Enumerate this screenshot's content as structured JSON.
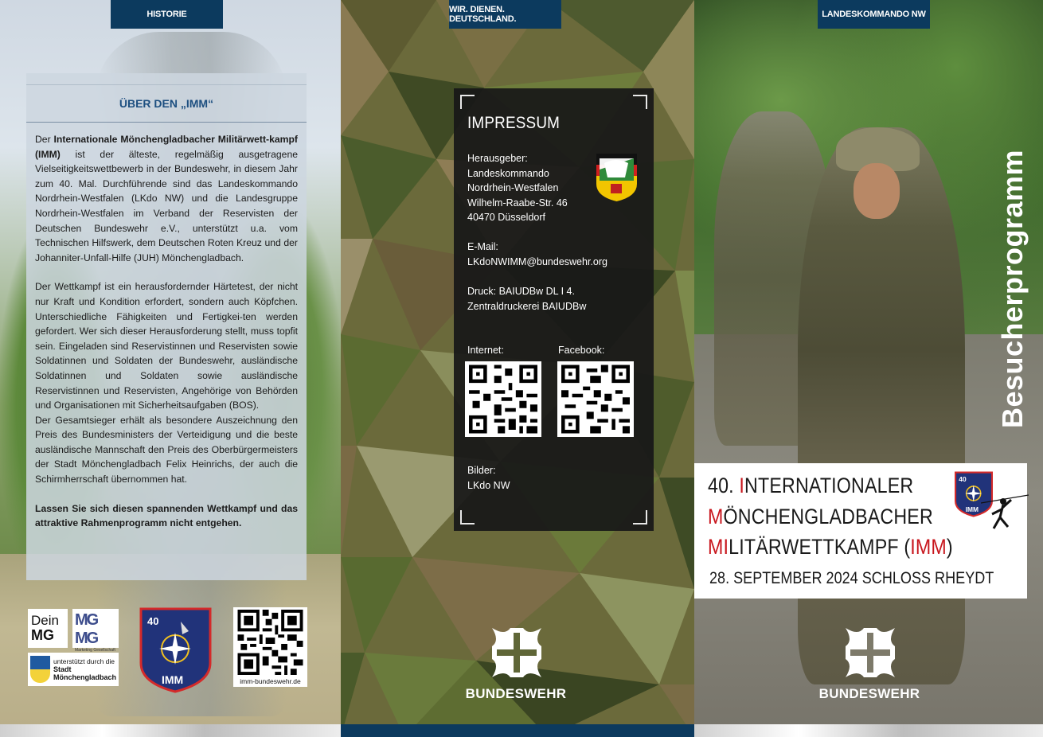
{
  "left": {
    "tab": "HISTORIE",
    "heading": "ÜBER DEN „IMM“",
    "p1_pre": "Der ",
    "p1_bold": "Internationale Mönchengladbacher Militärwett-kampf (IMM)",
    "p1_rest": " ist der älteste, regelmäßig ausgetragene Vielseitigkeitswettbewerb in der Bundeswehr, in diesem Jahr zum 40. Mal. Durchführende sind das Landeskommando Nordrhein-Westfalen (LKdo NW) und die Landesgruppe Nordrhein-Westfalen im Verband der Reservisten der Deutschen Bundeswehr e.V., unterstützt u.a. vom Technischen Hilfswerk, dem Deutschen Roten Kreuz und der Johanniter-Unfall-Hilfe (JUH) Mönchengladbach.",
    "p2": "Der Wettkampf ist ein herausfordernder Härtetest, der nicht nur Kraft und Kondition erfordert, sondern auch Köpfchen. Unterschiedliche Fähigkeiten und Fertigkei-ten werden gefordert. Wer sich dieser Herausforderung stellt, muss topfit sein. Eingeladen sind Reservistinnen und Reservisten sowie Soldatinnen und Soldaten der Bundeswehr, ausländische Soldatinnen und Soldaten sowie ausländische Reservistinnen und Reservisten, Angehörige von Behörden und Organisationen mit Sicherheitsaufgaben (BOS).",
    "p3": "Der Gesamtsieger erhält als besondere Auszeichnung den Preis des Bundesministers der Verteidigung und die beste ausländische Mannschaft den Preis des Oberbürgermeisters der Stadt Mönchengladbach Felix Heinrichs, der auch die Schirmherrschaft übernommen hat.",
    "closing_bold": "Lassen Sie sich diesen spannenden Wettkampf und das attraktive Rahmenprogramm nicht entgehen.",
    "logos": {
      "dein": "Dein",
      "mg": "MG",
      "mgmg": "MG MG",
      "mgmg_sub": "Marketing Gesellschaft Mönchengladbach mbH",
      "stadt_pre": "unterstützt durch die",
      "stadt": "Stadt",
      "stadt_name": "Mönchengladbach"
    },
    "badge_number": "40",
    "badge_text": "IMM",
    "qr_url": "imm-bundeswehr.de"
  },
  "middle": {
    "tab": "WIR. DIENEN. DEUTSCHLAND.",
    "impressum_title": "IMPRESSUM",
    "publisher_label": "Herausgeber:",
    "publisher_lines": [
      "Landeskommando",
      "Nordrhein-Westfalen",
      "Wilhelm-Raabe-Str. 46",
      "40470 Düsseldorf"
    ],
    "email_label": "E-Mail:",
    "email": "LKdoNWIMM@bundeswehr.org",
    "print_line1": "Druck: BAIUDBw DL I 4.",
    "print_line2": "Zentraldruckerei BAIUDBw",
    "internet_label": "Internet:",
    "facebook_label": "Facebook:",
    "images_label": "Bilder:",
    "images_value": "LKdo NW",
    "brand": "BUNDESWEHR"
  },
  "right": {
    "tab": "LANDESKOMMANDO NW",
    "vertical_title": "Besucherprogramm",
    "title_l1_a": "40. ",
    "title_l1_b": "I",
    "title_l1_c": "NTERNATIONALER",
    "title_l2_a": "M",
    "title_l2_b": "ÖNCHENGLADBACHER",
    "title_l3_a": "MI",
    "title_l3_b": "LITÄRWETTKAMPF (",
    "title_l3_c": "IMM",
    "title_l3_d": ")",
    "date": "28. SEPTEMBER 2024 SCHLOSS RHEYDT",
    "badge_number": "40",
    "badge_text": "IMM",
    "brand": "BUNDESWEHR"
  },
  "colors": {
    "navy": "#0c3a5e",
    "accent_red": "#c8161d",
    "heading_blue": "#1d4f80"
  }
}
